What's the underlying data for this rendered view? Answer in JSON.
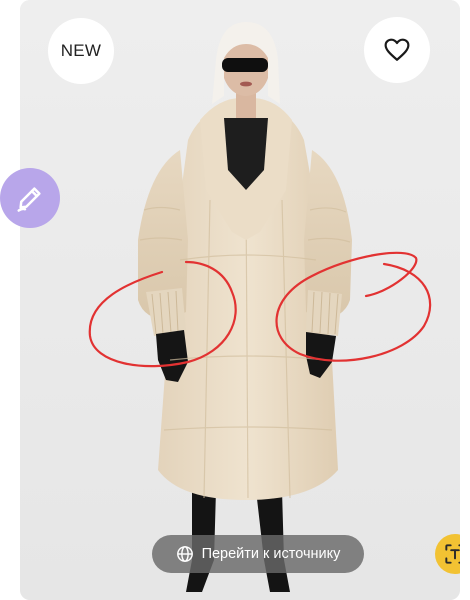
{
  "badge": {
    "text": "NEW"
  },
  "source_button": {
    "label": "Перейти к источнику"
  },
  "icons": {
    "favorite": "heart-outline-icon",
    "edit": "pencil-icon",
    "source": "globe-icon",
    "lens": "text-scan-icon"
  },
  "colors": {
    "edit_fab": "#b8a6ea",
    "lens_button": "#f2c233",
    "annotation": "#e23232"
  }
}
